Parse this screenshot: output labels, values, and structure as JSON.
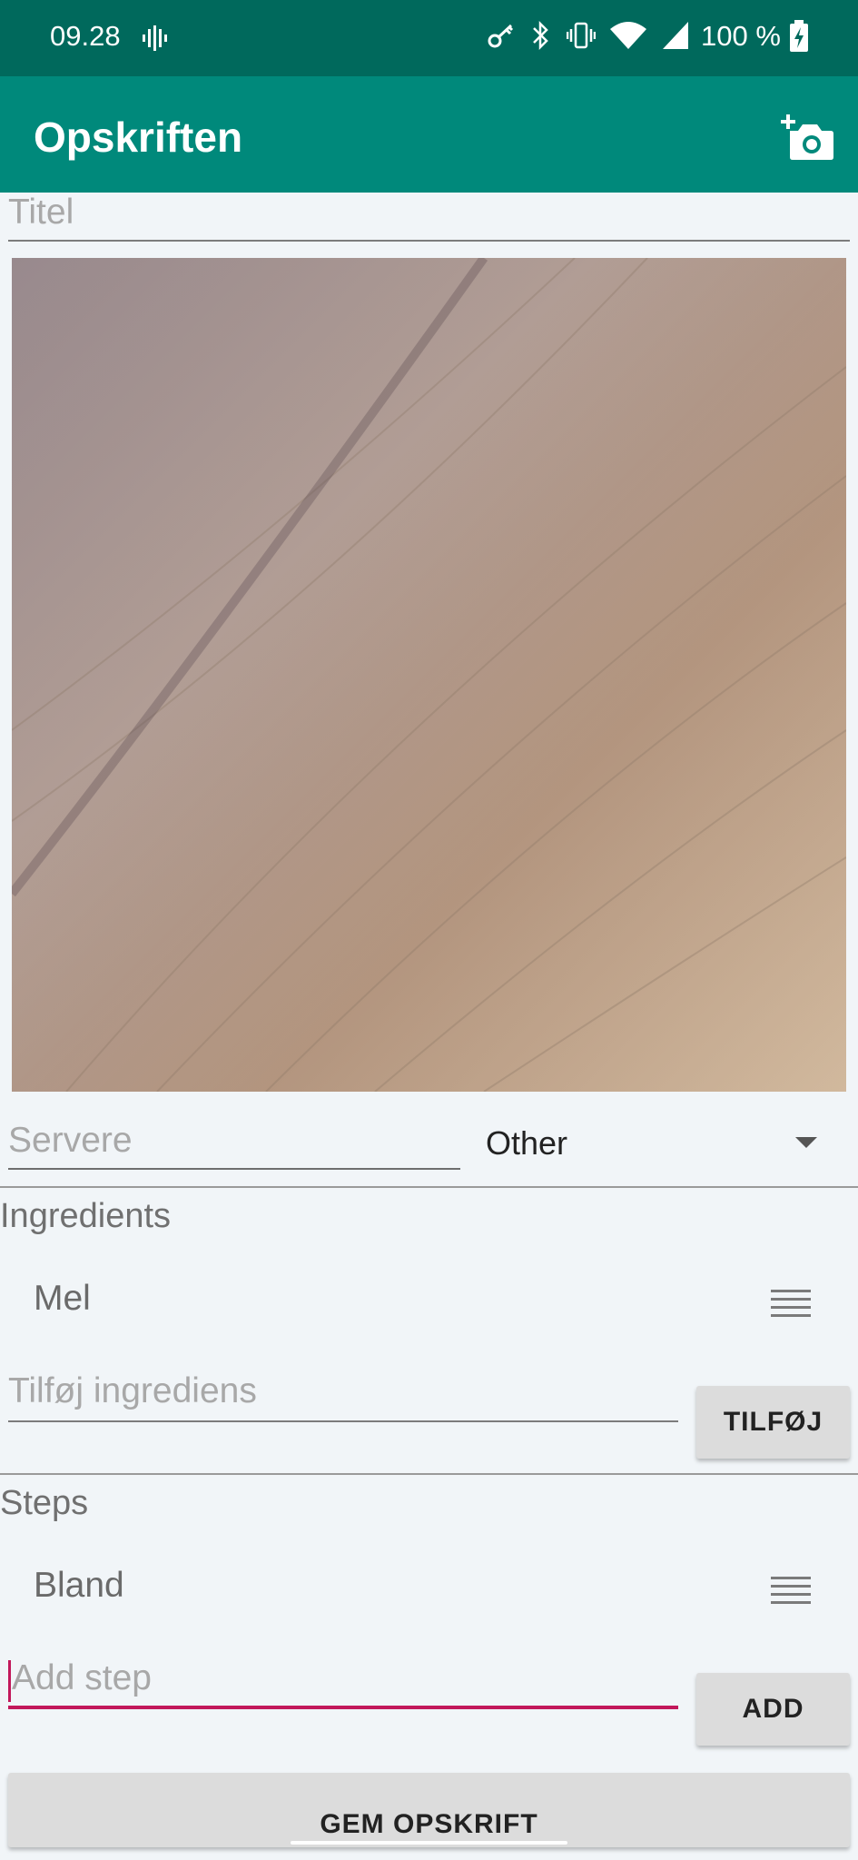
{
  "status_bar": {
    "time": "09.28",
    "battery_text": "100 %",
    "icons": [
      "assistant-icon",
      "vpn-key-icon",
      "bluetooth-icon",
      "vibrate-icon",
      "wifi-icon",
      "signal-icon",
      "battery-charging-icon"
    ]
  },
  "app_bar": {
    "title": "Opskriften",
    "action_icon": "add-photo-icon"
  },
  "form": {
    "title_placeholder": "Titel",
    "servings_placeholder": "Servere",
    "category_value": "Other"
  },
  "ingredients": {
    "label": "Ingredients",
    "items": [
      {
        "text": "Mel"
      }
    ],
    "input_placeholder": "Tilføj ingrediens",
    "add_button": "TILFØJ"
  },
  "steps": {
    "label": "Steps",
    "items": [
      {
        "text": "Bland"
      }
    ],
    "input_placeholder": "Add step",
    "add_button": "ADD"
  },
  "save_button": "GEM OPSKRIFT",
  "colors": {
    "status_bar": "#00695c",
    "app_bar": "#00897b",
    "background": "#f1f5f8",
    "focus_accent": "#c2185b"
  }
}
